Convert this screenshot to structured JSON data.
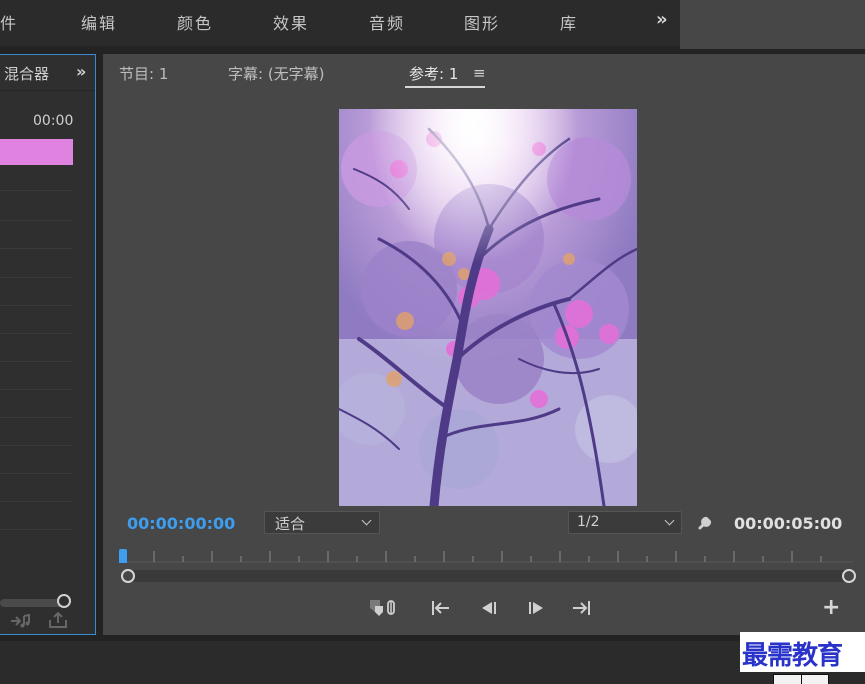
{
  "workspace_tabs": [
    "件",
    "编辑",
    "颜色",
    "效果",
    "音频",
    "图形",
    "库"
  ],
  "workspace_more": "»",
  "left_panel": {
    "title": "混合器",
    "more": "»",
    "time": "00:00",
    "clip_color": "#e083e0"
  },
  "monitor": {
    "tabs": [
      "节目: 1",
      "字幕: (无字幕)",
      "参考: 1"
    ],
    "active_tab": "参考: 1",
    "menu_icon": "≡",
    "timecode_current": "00:00:00:00",
    "fit_value": "适合",
    "resolution_value": "1/2",
    "timecode_duration": "00:00:05:00",
    "add_label": "+",
    "accent_color": "#3d9ef0"
  },
  "watermark": "最需教育"
}
